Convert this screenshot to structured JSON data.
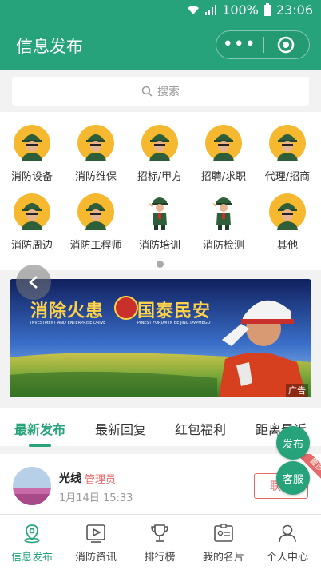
{
  "status_bar": {
    "battery": "100%",
    "time": "23:06"
  },
  "header": {
    "title": "信息发布"
  },
  "search": {
    "placeholder": "搜索"
  },
  "categories": [
    {
      "label": "消防设备",
      "avatar": "helmet-avatar"
    },
    {
      "label": "消防维保",
      "avatar": "helmet-avatar"
    },
    {
      "label": "招标/甲方",
      "avatar": "helmet-avatar"
    },
    {
      "label": "招聘/求职",
      "avatar": "helmet-avatar"
    },
    {
      "label": "代理/招商",
      "avatar": "helmet-avatar"
    },
    {
      "label": "消防周边",
      "avatar": "helmet-avatar"
    },
    {
      "label": "消防工程师",
      "avatar": "helmet-avatar"
    },
    {
      "label": "消防培训",
      "avatar": "saluting-officer"
    },
    {
      "label": "消防检测",
      "avatar": "saluting-officer"
    },
    {
      "label": "其他",
      "avatar": "helmet-avatar"
    }
  ],
  "banner": {
    "headline_left": "消除火患",
    "headline_right": "国泰民安",
    "sub_left": "INVESTMENT AND ENTERPRISE DRIVE",
    "sub_right": "PINEST FORUM IN BEIJING DVPMEGD",
    "ad_label": "广告"
  },
  "tabs": [
    "最新发布",
    "最新回复",
    "红包福利",
    "距离最近"
  ],
  "post": {
    "name": "光线",
    "role": "管理员",
    "time": "1月14日 15:33",
    "contact_label": "联系",
    "pinned_label": "置顶"
  },
  "fabs": {
    "publish": "发布",
    "service": "客服"
  },
  "bottom_nav": [
    {
      "label": "信息发布",
      "icon": "location-pin-icon"
    },
    {
      "label": "消防资讯",
      "icon": "video-play-icon"
    },
    {
      "label": "排行榜",
      "icon": "trophy-icon"
    },
    {
      "label": "我的名片",
      "icon": "id-card-icon"
    },
    {
      "label": "个人中心",
      "icon": "user-icon"
    }
  ],
  "colors": {
    "brand": "#26a37a",
    "accent_red": "#e56b6b",
    "avatar_bg": "#f5b82e"
  }
}
